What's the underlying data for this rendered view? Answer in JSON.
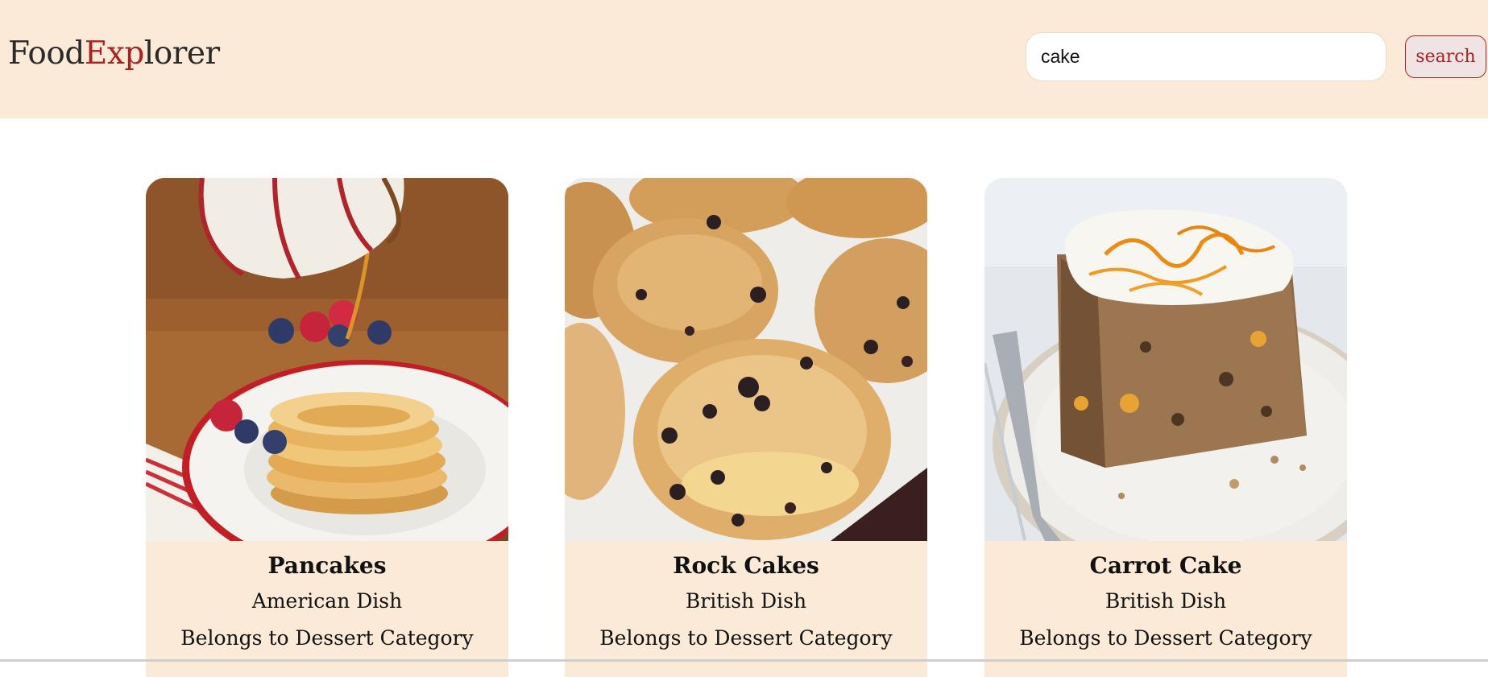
{
  "header": {
    "logo": {
      "part1": "Food",
      "part2": "Exp",
      "part3": "lorer"
    },
    "search": {
      "value": "cake",
      "button_label": "search"
    }
  },
  "colors": {
    "header_bg": "#faead7",
    "accent": "#a82222",
    "card_info_bg": "#faead7"
  },
  "meals": [
    {
      "name": "Pancakes",
      "area": "American Dish",
      "category": "Belongs to Dessert Category",
      "image": "pancakes-photo"
    },
    {
      "name": "Rock Cakes",
      "area": "British Dish",
      "category": "Belongs to Dessert Category",
      "image": "rock-cakes-photo"
    },
    {
      "name": "Carrot Cake",
      "area": "British Dish",
      "category": "Belongs to Dessert Category",
      "image": "carrot-cake-photo"
    }
  ]
}
